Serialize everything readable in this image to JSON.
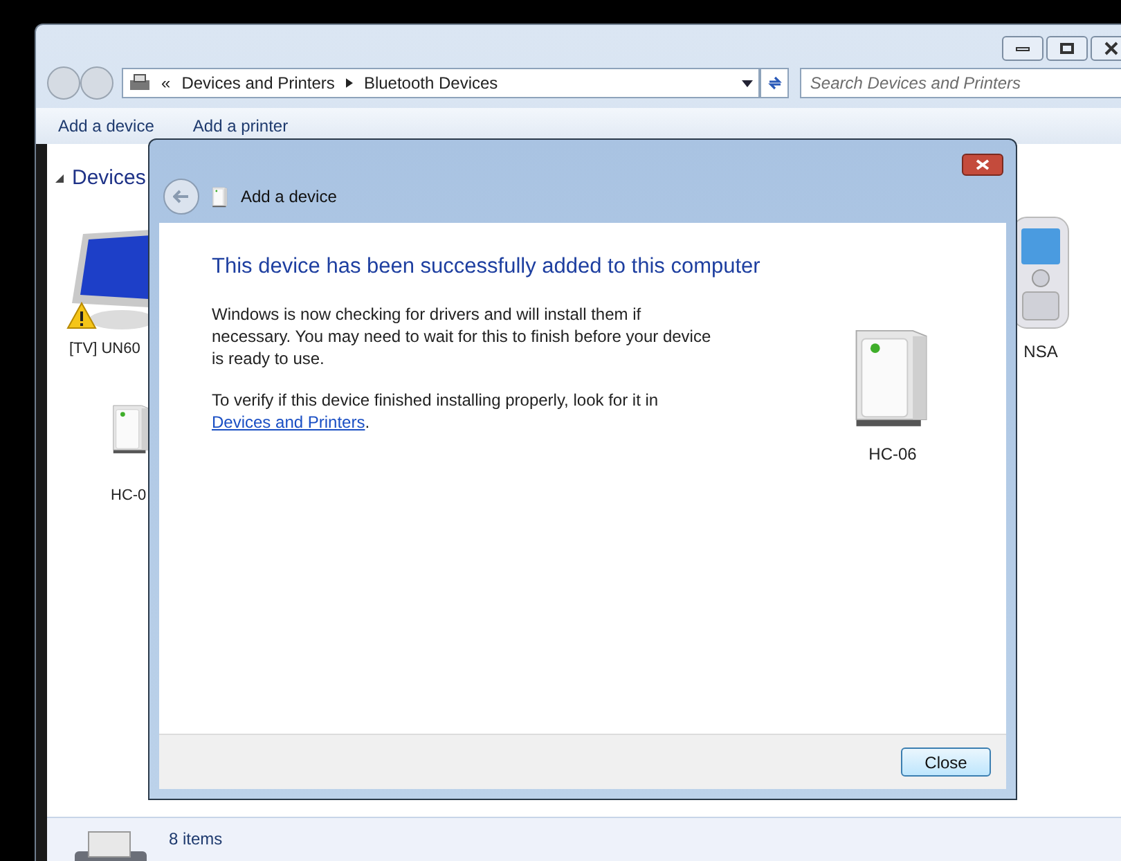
{
  "explorer": {
    "overflow_mark": "«",
    "breadcrumb": [
      "Devices and Printers",
      "Bluetooth Devices"
    ],
    "search": {
      "placeholder": "Search Devices and Printers"
    },
    "toolbar": [
      "Add a device",
      "Add a printer"
    ],
    "group": "Devices",
    "devices": [
      {
        "name": "[TV] UN60",
        "kind": "monitor",
        "warning": true
      },
      {
        "name": "HC-0",
        "kind": "tower",
        "warning": false
      },
      {
        "name": "NSA",
        "kind": "phone",
        "warning": false
      }
    ],
    "status": {
      "count": "8 items"
    }
  },
  "dialog": {
    "title": "Add a device",
    "heading": "This device has been successfully added to this computer",
    "paragraph": "Windows is now checking for drivers and will install them if necessary. You may need to wait for this to finish before your device is ready to use.",
    "verify_text": "To verify if this device finished installing properly, look for it in",
    "link": "Devices and Printers",
    "after_link": ".",
    "device_name": "HC-06",
    "button": "Close"
  }
}
